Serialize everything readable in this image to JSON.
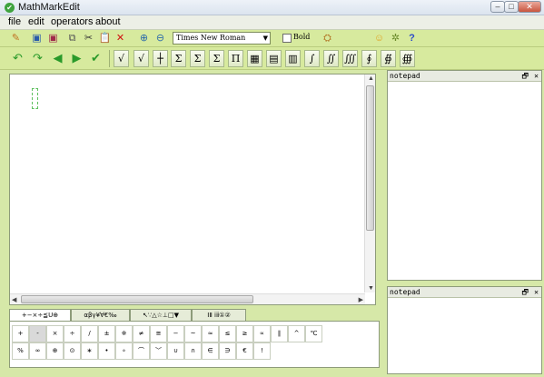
{
  "window": {
    "title": "MathMarkEdit",
    "min": "–",
    "max": "□",
    "close": "✕"
  },
  "menu": [
    "file",
    "edit",
    "operators",
    "about"
  ],
  "toolbar1": {
    "font": "Times New Roman",
    "bold_label": "Bold",
    "icons": [
      "edit-icon",
      "save-icon",
      "save-as-icon",
      "copy-icon",
      "cut-icon",
      "paste-icon",
      "delete-icon",
      "zoom-in-icon",
      "zoom-out-icon",
      "image-icon",
      "smiley-icon",
      "settings-icon",
      "help-icon"
    ]
  },
  "toolbar2": {
    "icons": [
      "undo-icon",
      "redo-icon",
      "back-icon",
      "forward-icon",
      "check-icon"
    ],
    "symbols": [
      "√",
      "√",
      "┼",
      "Σ",
      "Σ",
      "Σ",
      "Π",
      "▦",
      "▤",
      "▥",
      "∫",
      "∬",
      "∭",
      "∮",
      "∯",
      "∰"
    ]
  },
  "notepad": {
    "title": "notepad",
    "restore": "🗗",
    "close": "✕"
  },
  "tabs": [
    "+−×÷≦U⊕",
    "αβγ¥∀€‰",
    "↖∵△☆⊥□▼",
    "ⅠⅡ ⅰⅱ①②"
  ],
  "symbol_grid": {
    "row1": [
      "+",
      "-",
      "×",
      "÷",
      "/",
      "±",
      "※",
      "≠",
      "≅",
      "−",
      "~",
      "≈",
      "≤",
      "≥",
      "∝",
      "∥",
      "^",
      "℃"
    ],
    "row2": [
      "%",
      "∞",
      "⊕",
      "⊙",
      "∗",
      "•",
      "∘",
      "⌒",
      "﹀",
      "∪",
      "∩",
      "∈",
      "∋",
      "€",
      "!"
    ]
  }
}
